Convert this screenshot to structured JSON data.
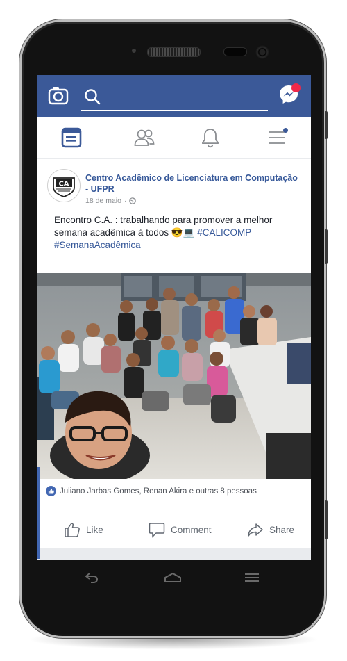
{
  "top_bar": {
    "camera_icon": "camera-icon",
    "search_icon": "search-icon",
    "messenger_icon": "messenger-icon",
    "notification_badge_color": "#f02849",
    "bar_color": "#3b5998"
  },
  "nav": {
    "items": [
      {
        "icon": "news-feed-icon",
        "active": true
      },
      {
        "icon": "friends-icon",
        "active": false
      },
      {
        "icon": "notifications-bell-icon",
        "active": false
      },
      {
        "icon": "menu-icon",
        "active": false
      }
    ]
  },
  "post": {
    "page_name": "Centro Acadêmico de Licenciatura em Computação - UFPR",
    "date": "18 de maio",
    "separator": "·",
    "text_before": "Encontro C.A. : trabalhando para promover a melhor semana acadêmica à todos 😎💻 ",
    "hashtag_1": "#CALICOMP",
    "hashtag_2": "#SemanaAcadêmica",
    "avatar_label": "CA",
    "reactions_text": "Juliano Jarbas Gomes, Renan Akira e outras 8 pessoas",
    "actions": {
      "like": "Like",
      "comment": "Comment",
      "share": "Share"
    }
  }
}
